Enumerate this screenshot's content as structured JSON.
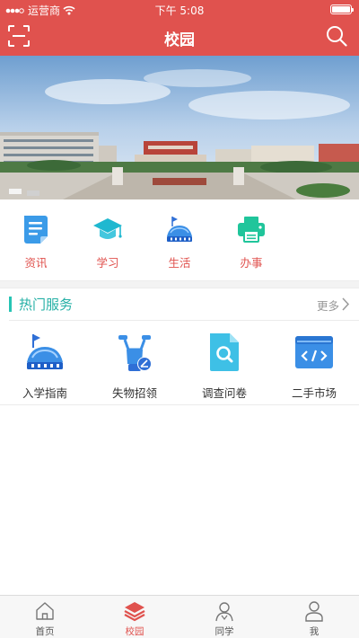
{
  "status_bar": {
    "carrier": "运营商",
    "time": "下午 5:08"
  },
  "header": {
    "title": "校园"
  },
  "quick_links": [
    {
      "label": "资讯",
      "icon": "document-icon"
    },
    {
      "label": "学习",
      "icon": "graduation-cap-icon"
    },
    {
      "label": "生活",
      "icon": "stadium-icon"
    },
    {
      "label": "办事",
      "icon": "printer-icon"
    }
  ],
  "hot_services": {
    "title": "热门服务",
    "more": "更多",
    "items": [
      {
        "label": "入学指南",
        "icon": "stadium-flag-icon"
      },
      {
        "label": "失物招领",
        "icon": "scooter-icon"
      },
      {
        "label": "调查问卷",
        "icon": "search-document-icon"
      },
      {
        "label": "二手市场",
        "icon": "code-window-icon"
      }
    ]
  },
  "tabs": [
    {
      "label": "首页",
      "icon": "home-icon",
      "active": false
    },
    {
      "label": "校园",
      "icon": "layers-icon",
      "active": true
    },
    {
      "label": "同学",
      "icon": "classmates-icon",
      "active": false
    },
    {
      "label": "我",
      "icon": "user-icon",
      "active": false
    }
  ],
  "colors": {
    "brand": "#e0524e",
    "accent": "#26c4b4",
    "icon_blue": "#3b8fe6",
    "icon_cyan": "#1fb8d0",
    "icon_green": "#20c59b"
  }
}
